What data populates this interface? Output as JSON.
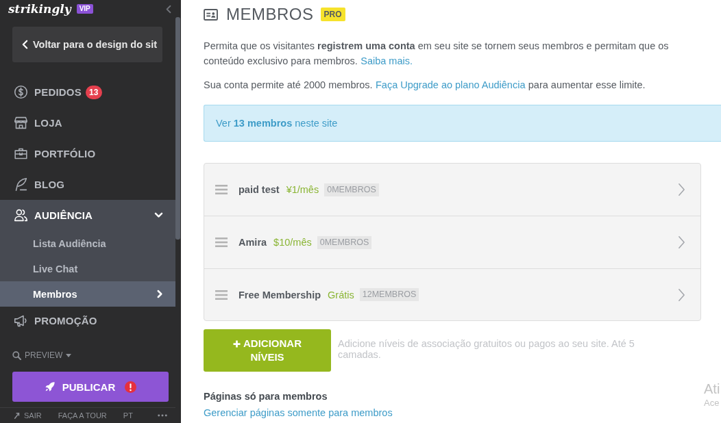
{
  "sidebar": {
    "logo": {
      "text": "strikingly",
      "badge": "VIP"
    },
    "back_button": {
      "label": "Voltar para o design do sit"
    },
    "nav": [
      {
        "label": "PEDIDOS",
        "badge": "13",
        "expanded": false
      },
      {
        "label": "LOJA",
        "expanded": false
      },
      {
        "label": "PORTFÓLIO",
        "expanded": false
      },
      {
        "label": "BLOG",
        "expanded": false
      },
      {
        "label": "AUDIÊNCIA",
        "expanded": true,
        "children": [
          {
            "label": "Lista Audiência",
            "selected": false
          },
          {
            "label": "Live Chat",
            "selected": false
          },
          {
            "label": "Membros",
            "selected": true
          }
        ]
      },
      {
        "label": "PROMOÇÃO",
        "expanded": false
      }
    ],
    "preview": {
      "label": "PREVIEW"
    },
    "publish_button": {
      "label": "PUBLICAR",
      "warning": true
    },
    "footer": [
      {
        "label": "SAIR"
      },
      {
        "label": "FAÇA A TOUR"
      },
      {
        "label": "PT"
      }
    ]
  },
  "page": {
    "title": "MEMBROS",
    "badge": "PRO",
    "intro": {
      "lines": [
        "Permita que os visitantes **registrem uma conta** em seu site se tornem seus membros e permitam que os",
        "conteúdo exclusivo para membros."
      ],
      "link": "Saiba mais."
    },
    "limit": {
      "before": "Sua conta permite até 2000 membros.",
      "link": "Faça Upgrade ao plano Audiência",
      "after": "para aumentar esse limite."
    },
    "banner": "Ver **13 membros** neste site",
    "levels": [
      {
        "name": "paid test",
        "price": "¥1/mês",
        "members": "0MEMBROS"
      },
      {
        "name": "Amira",
        "price": "$10/mês",
        "members": "0MEMBROS"
      },
      {
        "name": "Free Membership",
        "price": "Grátis",
        "members": "12MEMBROS"
      }
    ],
    "add_button": {
      "label": "ADICIONAR NÍVEIS"
    },
    "add_hint": "Adicione níveis de associação gratuitos ou pagos ao seu site. Até 5 camadas.",
    "pages_section": {
      "title": "Páginas só para membros",
      "link": "Gerenciar páginas somente para membros"
    }
  },
  "os_overlay": {
    "title": "Ati",
    "subtitle": "Ace"
  }
}
